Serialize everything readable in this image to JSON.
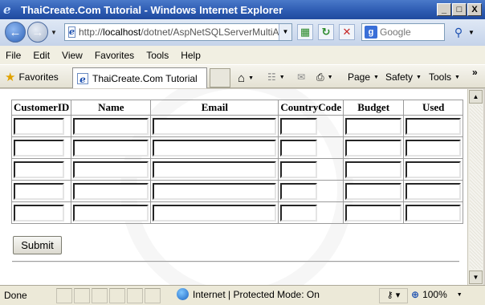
{
  "window": {
    "title": "ThaiCreate.Com Tutorial - Windows Internet Explorer",
    "controls": [
      "_",
      "□",
      "X"
    ]
  },
  "address": {
    "url_prefix": "http://",
    "url_host": "localhost",
    "url_path": "/dotnet/AspNetSQLServerMultiAdd.",
    "search_placeholder": "Google"
  },
  "menu": {
    "items": [
      "File",
      "Edit",
      "View",
      "Favorites",
      "Tools",
      "Help"
    ]
  },
  "favbar": {
    "favorites_label": "Favorites",
    "tab_label": "ThaiCreate.Com Tutorial",
    "page_label": "Page",
    "safety_label": "Safety",
    "tools_label": "Tools"
  },
  "form": {
    "columns": [
      "CustomerID",
      "Name",
      "Email",
      "CountryCode",
      "Budget",
      "Used"
    ],
    "row_count": 5,
    "submit_label": "Submit"
  },
  "statusbar": {
    "status": "Done",
    "zone": "Internet | Protected Mode: On",
    "zoom": "100%"
  }
}
